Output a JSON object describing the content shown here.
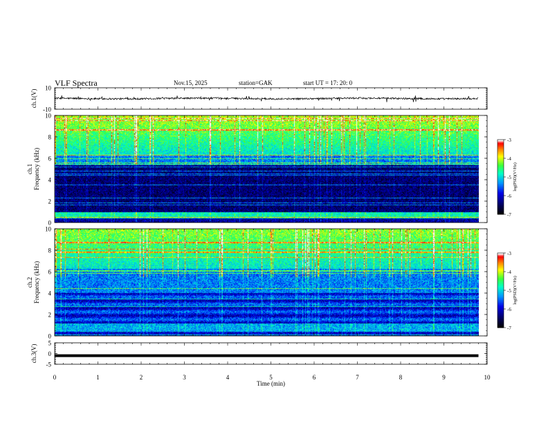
{
  "header": {
    "title": "VLF  Spectra",
    "date": "Nov.15, 2025",
    "station": "station=GAK",
    "start": "start  UT  =   17: 20: 0"
  },
  "colors": {
    "colormap": [
      "#000000",
      "#000066",
      "#0000ff",
      "#00a0ff",
      "#00ffc8",
      "#40ff40",
      "#ffff00",
      "#ff8000",
      "#ff0000",
      "#ffffff"
    ]
  },
  "chart_data": [
    {
      "type": "line",
      "name": "ch1-waveform",
      "ylabel": "ch.1(V)",
      "ylim": [
        -10,
        10
      ],
      "yticks": [
        "10",
        "-10"
      ],
      "xlim": [
        0,
        10
      ],
      "approx_level": 0
    },
    {
      "type": "heatmap",
      "name": "ch1-spectrogram",
      "ylabel": "ch.1\nFrequency  (kHz)",
      "ylim": [
        0,
        10
      ],
      "yticks": [
        "0",
        "2",
        "4",
        "6",
        "8",
        "10"
      ],
      "xlim": [
        0,
        10
      ],
      "data_end_min": 9.8,
      "colorbar": {
        "label": "log(PSD)(V²/Hz)",
        "range": [
          -7,
          -3
        ],
        "ticks": [
          "-3",
          "-4",
          "-5",
          "-6",
          "-7"
        ]
      }
    },
    {
      "type": "heatmap",
      "name": "ch2-spectrogram",
      "ylabel": "ch.2\nFrequency  (kHz)",
      "ylim": [
        0,
        10
      ],
      "yticks": [
        "0",
        "2",
        "4",
        "6",
        "8",
        "10"
      ],
      "xlim": [
        0,
        10
      ],
      "data_end_min": 9.8,
      "colorbar": {
        "label": "log(PSD)(V²/Hz)",
        "range": [
          -7,
          -3
        ],
        "ticks": [
          "-3",
          "-4",
          "-5",
          "-6",
          "-7"
        ]
      }
    },
    {
      "type": "line",
      "name": "ch3-waveform",
      "ylabel": "ch.3(V)",
      "ylim": [
        -5,
        5
      ],
      "yticks": [
        "5",
        "0",
        "-5"
      ],
      "xlim": [
        0,
        10
      ],
      "approx_level": -1
    }
  ],
  "x_axis": {
    "label": "Time  (min)",
    "ticks": [
      "0",
      "1",
      "2",
      "3",
      "4",
      "5",
      "6",
      "7",
      "8",
      "9",
      "10"
    ]
  }
}
